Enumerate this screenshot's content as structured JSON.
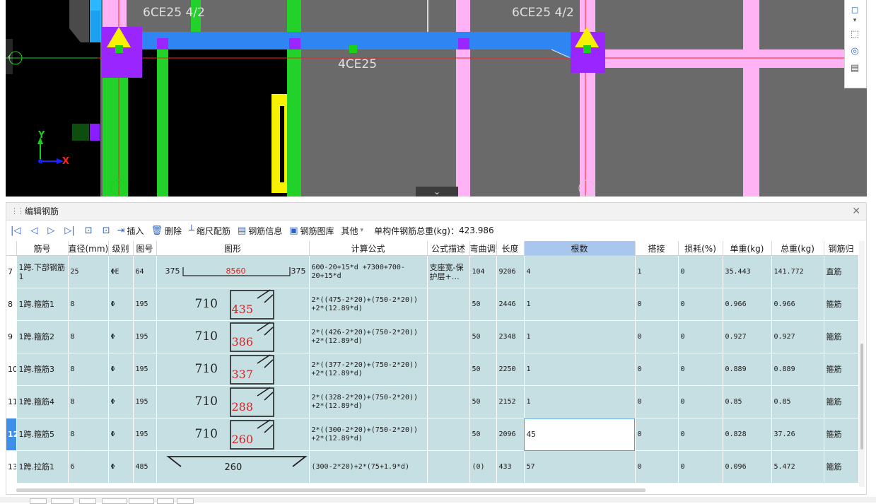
{
  "viewport": {
    "labels": {
      "top_left": "6CE25 4/2",
      "top_right": "6CE25 4/2",
      "middle": "4CE25"
    },
    "axis": {
      "y": "Y",
      "x": "X"
    },
    "markers": {
      "left": "3",
      "right": ""
    },
    "colors": {
      "background": "#6a6a6a",
      "beam": "#2f86f2",
      "column_pink": "#ffb3f5",
      "column_green": "#22d22a",
      "support": "#9a25ff",
      "triangle": "#f7f000"
    }
  },
  "panel": {
    "title": "编辑钢筋",
    "close_icon": "close-icon",
    "toolbar": {
      "insert": "插入",
      "delete": "删除",
      "scale": "缩尺配筋",
      "info": "钢筋信息",
      "library": "钢筋图库",
      "other": "其他",
      "total_label": "单构件钢筋总重(kg)：",
      "total_value": "423.986"
    },
    "columns": [
      "",
      "筋号",
      "直径(mm)",
      "级别",
      "图号",
      "图形",
      "计算公式",
      "公式描述",
      "弯曲调整",
      "长度",
      "根数",
      "搭接",
      "损耗(%)",
      "单重(kg)",
      "总重(kg)",
      "钢筋归"
    ],
    "selected_column": "根数",
    "current_row": "12",
    "rows": [
      {
        "no": "7",
        "name": "1跨.下部钢筋1",
        "dia": "25",
        "grade": "ΦE",
        "fig": "64",
        "shape": {
          "type": "straight",
          "left": "375",
          "mid": "8560",
          "right": "375"
        },
        "formula": "600-20+15*d +7300+700-20+15*d",
        "desc": "支座宽-保护层+…",
        "bend": "104",
        "len": "9206",
        "count": "4",
        "lap": "1",
        "loss": "0",
        "unit": "35.443",
        "total": "141.772",
        "type": "直筋"
      },
      {
        "no": "8",
        "name": "1跨.箍筋1",
        "dia": "8",
        "grade": "Φ",
        "fig": "195",
        "shape": {
          "type": "stirrup",
          "a": "710",
          "b": "435"
        },
        "formula": "2*((475-2*20)+(750-2*20)) +2*(12.89*d)",
        "desc": "",
        "bend": "50",
        "len": "2446",
        "count": "1",
        "lap": "0",
        "loss": "0",
        "unit": "0.966",
        "total": "0.966",
        "type": "箍筋"
      },
      {
        "no": "9",
        "name": "1跨.箍筋2",
        "dia": "8",
        "grade": "Φ",
        "fig": "195",
        "shape": {
          "type": "stirrup",
          "a": "710",
          "b": "386"
        },
        "formula": "2*((426-2*20)+(750-2*20)) +2*(12.89*d)",
        "desc": "",
        "bend": "50",
        "len": "2348",
        "count": "1",
        "lap": "0",
        "loss": "0",
        "unit": "0.927",
        "total": "0.927",
        "type": "箍筋"
      },
      {
        "no": "10",
        "name": "1跨.箍筋3",
        "dia": "8",
        "grade": "Φ",
        "fig": "195",
        "shape": {
          "type": "stirrup",
          "a": "710",
          "b": "337"
        },
        "formula": "2*((377-2*20)+(750-2*20)) +2*(12.89*d)",
        "desc": "",
        "bend": "50",
        "len": "2250",
        "count": "1",
        "lap": "0",
        "loss": "0",
        "unit": "0.889",
        "total": "0.889",
        "type": "箍筋"
      },
      {
        "no": "11",
        "name": "1跨.箍筋4",
        "dia": "8",
        "grade": "Φ",
        "fig": "195",
        "shape": {
          "type": "stirrup",
          "a": "710",
          "b": "288"
        },
        "formula": "2*((328-2*20)+(750-2*20)) +2*(12.89*d)",
        "desc": "",
        "bend": "50",
        "len": "2152",
        "count": "1",
        "lap": "0",
        "loss": "0",
        "unit": "0.85",
        "total": "0.85",
        "type": "箍筋"
      },
      {
        "no": "12",
        "name": "1跨.箍筋5",
        "dia": "8",
        "grade": "Φ",
        "fig": "195",
        "shape": {
          "type": "stirrup",
          "a": "710",
          "b": "260"
        },
        "formula": "2*((300-2*20)+(750-2*20)) +2*(12.89*d)",
        "desc": "",
        "bend": "50",
        "len": "2096",
        "count": "45",
        "lap": "0",
        "loss": "0",
        "unit": "0.828",
        "total": "37.26",
        "type": "箍筋"
      },
      {
        "no": "13",
        "name": "1跨.拉筋1",
        "dia": "6",
        "grade": "Φ",
        "fig": "485",
        "shape": {
          "type": "hook",
          "mid": "260"
        },
        "formula": "(300-2*20)+2*(75+1.9*d)",
        "desc": "",
        "bend": "(0)",
        "len": "433",
        "count": "57",
        "lap": "0",
        "loss": "0",
        "unit": "0.096",
        "total": "5.472",
        "type": "箍筋"
      }
    ]
  }
}
